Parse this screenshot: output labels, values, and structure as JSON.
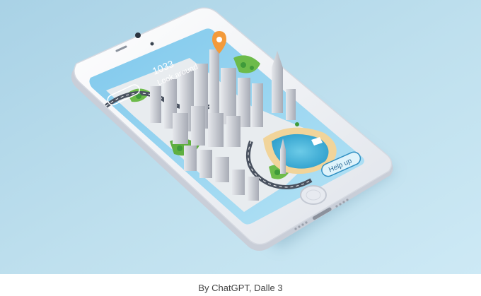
{
  "caption": "By ChatGPT, Dalle 3",
  "illustration": {
    "screen_number": "1033",
    "screen_heading": "Look around",
    "screen_button": "Help up",
    "icons": [
      "location-pin-icon",
      "camera-icon",
      "home-button-icon"
    ],
    "colors": {
      "backdrop": "#bfe0ee",
      "phone_body": "#f4f5f8",
      "screen_sky": "#8ed0ee",
      "water": "#4fb5da",
      "beach": "#f1d49a",
      "grass": "#6dbb4a",
      "buildings": "#c9ccd3",
      "pin": "#f39a3a"
    }
  }
}
